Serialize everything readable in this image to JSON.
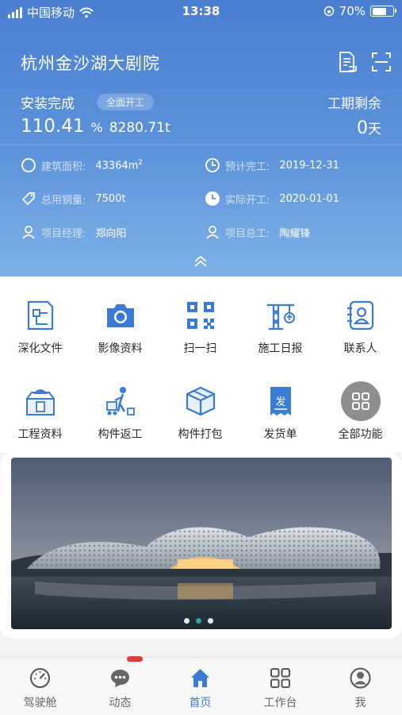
{
  "status_bar": {
    "carrier": "中国移动",
    "time": "13:38",
    "battery": "70%",
    "battery_level": 0.7
  },
  "header": {
    "title": "杭州金沙湖大剧院",
    "install_label": "安装完成",
    "stage_badge": "全面开工",
    "remaining_label": "工期剩余",
    "completed_value": "110.41",
    "completed_unit": "%",
    "total_weight": "8280.71t",
    "remaining_value": "0",
    "remaining_unit": "天",
    "info": {
      "building_area_label": "建筑面积:",
      "building_area_value": "43364m",
      "building_area_sup": "2",
      "planned_finish_label": "预计完工:",
      "planned_finish_value": "2019-12-31",
      "total_steel_label": "总用钢量:",
      "total_steel_value": "7500t",
      "actual_start_label": "实际开工:",
      "actual_start_value": "2020-01-01",
      "manager_label": "项目经理:",
      "manager_value": "郑向阳",
      "chief_engineer_label": "项目总工:",
      "chief_engineer_value": "陶耀锋"
    }
  },
  "menu": {
    "items": [
      {
        "label": "深化文件",
        "icon": "blueprint-icon"
      },
      {
        "label": "影像资料",
        "icon": "camera-icon"
      },
      {
        "label": "扫一扫",
        "icon": "qr-code-icon"
      },
      {
        "label": "施工日报",
        "icon": "crane-icon"
      },
      {
        "label": "联系人",
        "icon": "contact-icon"
      },
      {
        "label": "工程资料",
        "icon": "engineering-docs-icon"
      },
      {
        "label": "构件返工",
        "icon": "rework-worker-icon"
      },
      {
        "label": "构件打包",
        "icon": "package-icon"
      },
      {
        "label": "发货单",
        "icon": "delivery-note-icon"
      },
      {
        "label": "全部功能",
        "icon": "all-functions-icon"
      }
    ],
    "delivery_icon_char": "发"
  },
  "banner": {
    "page_count": 3,
    "active_page": 2
  },
  "tabbar": {
    "tabs": [
      {
        "label": "驾驶舱",
        "icon": "speedometer-icon"
      },
      {
        "label": "动态",
        "icon": "chat-icon"
      },
      {
        "label": "首页",
        "icon": "home-icon"
      },
      {
        "label": "工作台",
        "icon": "grid-icon"
      },
      {
        "label": "我",
        "icon": "person-icon"
      }
    ],
    "active": "首页"
  },
  "colors": {
    "accent": "#3a7bd5",
    "header_top": "#4a7fd0",
    "header_bottom": "#7fb1e8",
    "badge_red": "#e53935",
    "dot_active": "#2fb4a8"
  }
}
